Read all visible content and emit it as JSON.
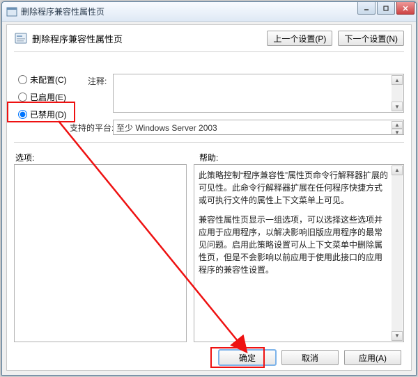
{
  "window": {
    "title": "删除程序兼容性属性页"
  },
  "nav": {
    "prev": "上一个设置(P)",
    "next": "下一个设置(N)"
  },
  "header": {
    "title": "删除程序兼容性属性页"
  },
  "radios": {
    "not_configured": "未配置(C)",
    "enabled": "已启用(E)",
    "disabled": "已禁用(D)",
    "selected": "disabled"
  },
  "labels": {
    "comment": "注释:",
    "platform": "支持的平台:",
    "options": "选项:",
    "help": "帮助:"
  },
  "fields": {
    "comment_value": "",
    "platform_value": "至少 Windows Server 2003"
  },
  "help": {
    "p1": "此策略控制“程序兼容性”属性页命令行解释器扩展的可见性。此命令行解释器扩展在任何程序快捷方式或可执行文件的属性上下文菜单上可见。",
    "p2": "兼容性属性页显示一组选项，可以选择这些选项并应用于应用程序，以解决影响旧版应用程序的最常见问题。启用此策略设置可从上下文菜单中删除属性页，但是不会影响以前应用于使用此接口的应用程序的兼容性设置。"
  },
  "buttons": {
    "ok": "确定",
    "cancel": "取消",
    "apply": "应用(A)"
  }
}
